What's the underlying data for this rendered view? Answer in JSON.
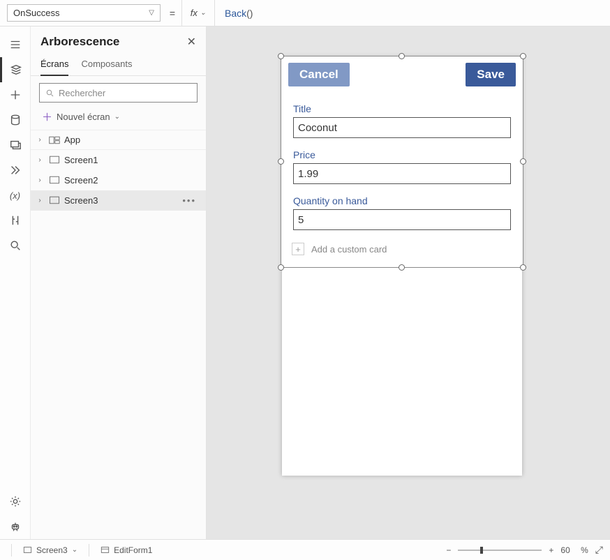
{
  "formulaBar": {
    "property": "OnSuccess",
    "fxLabel": "fx",
    "functionName": "Back",
    "parenOpen": "(",
    "parenClose": ")"
  },
  "panel": {
    "title": "Arborescence",
    "tabs": {
      "screens": "Écrans",
      "components": "Composants"
    },
    "searchPlaceholder": "Rechercher",
    "newScreen": "Nouvel écran",
    "tree": {
      "app": "App",
      "screen1": "Screen1",
      "screen2": "Screen2",
      "screen3": "Screen3"
    }
  },
  "form": {
    "cancel": "Cancel",
    "save": "Save",
    "fields": {
      "titleLabel": "Title",
      "titleValue": "Coconut",
      "priceLabel": "Price",
      "priceValue": "1.99",
      "qtyLabel": "Quantity on hand",
      "qtyValue": "5"
    },
    "addCard": "Add a custom card"
  },
  "statusBar": {
    "breadcrumbScreen": "Screen3",
    "breadcrumbControl": "EditForm1",
    "zoomPercent": "60",
    "percentSign": "%"
  }
}
